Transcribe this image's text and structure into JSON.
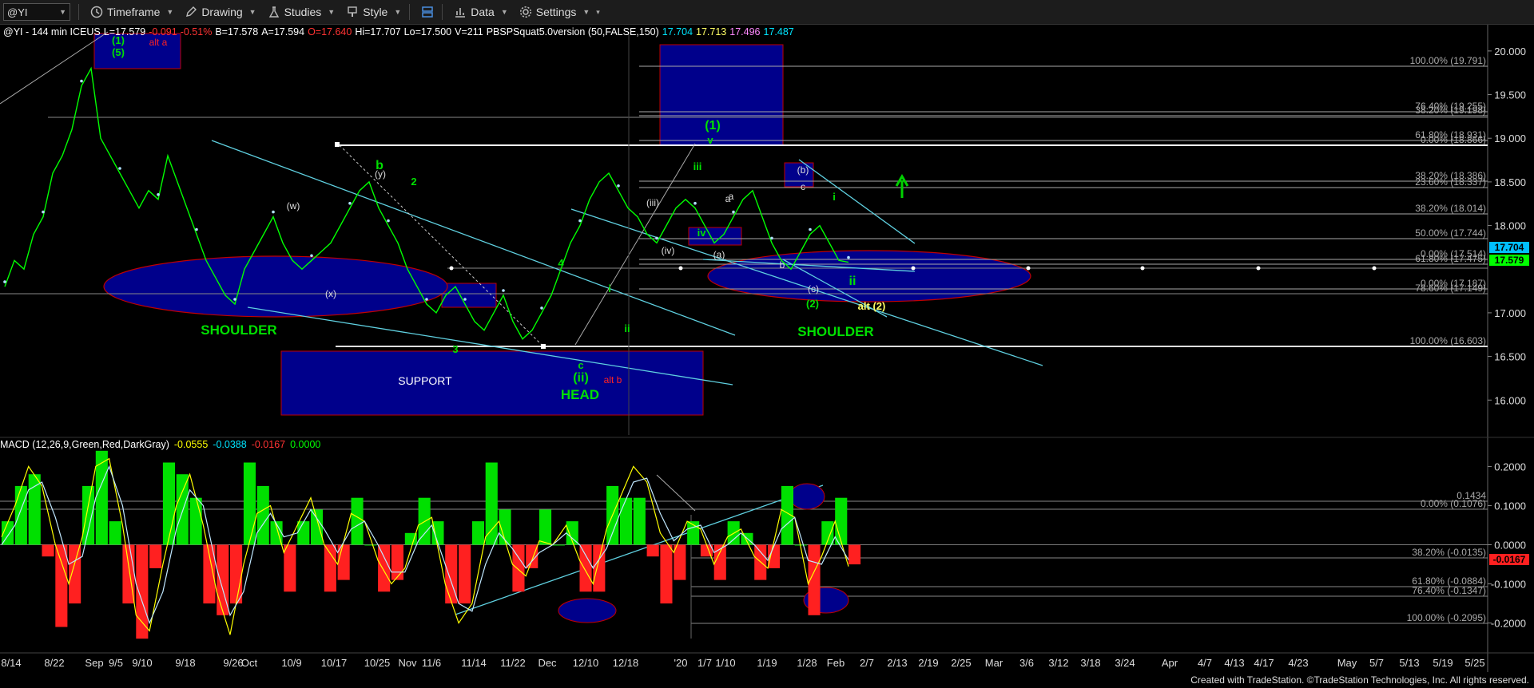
{
  "toolbar": {
    "symbol": "@YI",
    "timeframe": "Timeframe",
    "drawing": "Drawing",
    "studies": "Studies",
    "style": "Style",
    "data": "Data",
    "settings": "Settings"
  },
  "header": {
    "symbol_info": "@YI - 144 min  ICEUS",
    "last": "L=17.579",
    "change": "-0.091",
    "pct": "-0.51%",
    "bid": "B=17.578",
    "ask": "A=17.594",
    "open": "O=17.640",
    "high": "Hi=17.707",
    "low": "Lo=17.500",
    "volume": "V=211",
    "study": "PBSPSquat5.0version (50,FALSE,150)",
    "study_vals": [
      "17.704",
      "17.713",
      "17.496",
      "17.487"
    ],
    "colors": {
      "text": "#ffffff",
      "down": "#ff3333",
      "study": "#00e5ff"
    }
  },
  "macd_header": {
    "label": "MACD (12,26,9,Green,Red,DarkGray)",
    "vals": [
      "-0.0555",
      "-0.0388",
      "-0.0167",
      "0.0000"
    ],
    "colors": [
      "#ffff00",
      "#00e5ff",
      "#ff3333",
      "#00ff00"
    ]
  },
  "chart_data": [
    {
      "type": "line",
      "title": "@YI - 144 min ICEUS",
      "x": [
        "8/14",
        "8/22",
        "Sep",
        "9/5",
        "9/10",
        "9/18",
        "9/26",
        "Oct",
        "10/9",
        "10/17",
        "10/25",
        "Nov",
        "11/6",
        "11/14",
        "11/22",
        "Dec",
        "12/10",
        "12/18",
        "'20",
        "1/7",
        "1/10",
        "1/19",
        "1/28",
        "Feb",
        "2/7",
        "2/13",
        "2/19",
        "2/25",
        "Mar",
        "3/6",
        "3/12",
        "3/18",
        "3/24",
        "Apr",
        "4/7",
        "4/13",
        "4/17",
        "4/23",
        "May",
        "5/7",
        "5/13",
        "5/19",
        "5/25"
      ],
      "ylim": [
        15.6,
        20.2
      ],
      "yticks": [
        "20.000",
        "19.500",
        "19.000",
        "18.500",
        "18.000",
        "17.000",
        "16.500",
        "16.000"
      ],
      "last_price_labels": [
        "17.704",
        "17.579"
      ],
      "series": [
        {
          "values": [
            17.3,
            17.6,
            17.5,
            17.9,
            18.1,
            18.6,
            18.8,
            19.1,
            19.6,
            19.8,
            19.0,
            18.8,
            18.6,
            18.4,
            18.2,
            18.4,
            18.3,
            18.8,
            18.5,
            18.2,
            17.9,
            17.6,
            17.4,
            17.2,
            17.1,
            17.5,
            17.7,
            17.9,
            18.1,
            17.8,
            17.6,
            17.5,
            17.6,
            17.7,
            17.8,
            18.0,
            18.2,
            18.4,
            18.5,
            18.2,
            18.0,
            17.8,
            17.5,
            17.3,
            17.1,
            17.0,
            17.2,
            17.3,
            17.1,
            16.9,
            16.8,
            17.0,
            17.2,
            16.9,
            16.7,
            16.8,
            17.0,
            17.2,
            17.5,
            17.8,
            18.0,
            18.3,
            18.5,
            18.6,
            18.4,
            18.2,
            18.1,
            17.9,
            17.8,
            18.0,
            18.2,
            18.3,
            18.2,
            18.0,
            17.8,
            17.9,
            18.1,
            18.3,
            18.4,
            18.1,
            17.8,
            17.6,
            17.5,
            17.7,
            17.9,
            18.0,
            17.8,
            17.6,
            17.579
          ]
        }
      ],
      "fib_labels": [
        "100.00% (19.791)",
        "76.40% (19.255)",
        "38.20% (19.198)",
        "61.80% (18.931)",
        "0.00% (18.866)",
        "38.20% (18.386)",
        "23.60% (18.337)",
        "38.20% (18.014)",
        "50.00% (17.744)",
        "0.00% (17.514)",
        "61.80% (17.475)",
        "0.00% (17.187)",
        "78.60% (17.149)",
        "100.00% (16.603)"
      ],
      "wave_labels": {
        "green": [
          "(1)",
          "(5)",
          "b",
          "2",
          "4",
          "3",
          "c",
          "(ii)",
          "ii",
          "(1)",
          "iii",
          "v",
          "iv",
          "i",
          "ii",
          "(2)",
          "i"
        ],
        "white": [
          "(y)",
          "(w)",
          "(x)",
          "(iii)",
          "(iv)",
          "a",
          "(a)",
          "b",
          "c",
          "(b)",
          "(c)",
          "a"
        ],
        "red": [
          "alt a",
          "alt b"
        ],
        "yellow": [
          "alt (2)"
        ],
        "pattern": [
          "SHOULDER",
          "HEAD",
          "SHOULDER"
        ]
      },
      "support_label": "SUPPORT"
    },
    {
      "type": "line",
      "title": "MACD (12,26,9,Green,Red,DarkGray)",
      "ylim": [
        -0.26,
        0.26
      ],
      "yticks": [
        "0.2000",
        "0.1000",
        "0.0000",
        "-0.1000",
        "-0.2000"
      ],
      "series": [
        {
          "name": "MACD",
          "values": [
            0.02,
            0.1,
            0.2,
            0.15,
            0.0,
            -0.1,
            0.02,
            0.2,
            0.22,
            0.05,
            -0.18,
            -0.22,
            -0.05,
            0.1,
            0.18,
            0.05,
            -0.12,
            -0.23,
            -0.05,
            0.08,
            0.1,
            -0.02,
            0.05,
            0.12,
            0.0,
            -0.05,
            0.08,
            0.06,
            -0.04,
            -0.1,
            -0.06,
            0.05,
            0.07,
            -0.1,
            -0.2,
            -0.15,
            0.02,
            0.06,
            -0.05,
            -0.08,
            0.01,
            0.0,
            0.05,
            -0.04,
            -0.1,
            0.04,
            0.12,
            0.2,
            0.16,
            0.03,
            -0.02,
            0.06,
            0.04,
            -0.05,
            0.02,
            0.04,
            -0.03,
            -0.06,
            0.09,
            0.07,
            -0.1,
            -0.03,
            0.06,
            -0.0555
          ]
        },
        {
          "name": "Signal",
          "values": [
            0.0,
            0.05,
            0.14,
            0.16,
            0.07,
            -0.05,
            -0.03,
            0.12,
            0.2,
            0.1,
            -0.1,
            -0.2,
            -0.12,
            0.04,
            0.14,
            0.1,
            -0.06,
            -0.18,
            -0.12,
            0.03,
            0.08,
            0.02,
            0.03,
            0.09,
            0.04,
            -0.02,
            0.04,
            0.06,
            0.0,
            -0.07,
            -0.07,
            0.01,
            0.05,
            -0.05,
            -0.15,
            -0.17,
            -0.05,
            0.03,
            -0.01,
            -0.06,
            -0.02,
            0.0,
            0.03,
            0.0,
            -0.06,
            -0.01,
            0.08,
            0.16,
            0.17,
            0.08,
            0.01,
            0.04,
            0.05,
            -0.02,
            0.0,
            0.03,
            0.0,
            -0.04,
            0.04,
            0.07,
            -0.04,
            -0.05,
            0.02,
            -0.0388
          ]
        }
      ],
      "fib_labels": [
        "0.1434",
        "0.00% (0.1076)",
        "38.20% (-0.0135)",
        "61.80% (-0.0884)",
        "76.40% (-0.1347)",
        "100.00% (-0.2095)"
      ],
      "last_value_label": "-0.0167"
    }
  ],
  "footer": {
    "credit": "Created with TradeStation. ©TradeStation Technologies, Inc. All rights reserved."
  }
}
